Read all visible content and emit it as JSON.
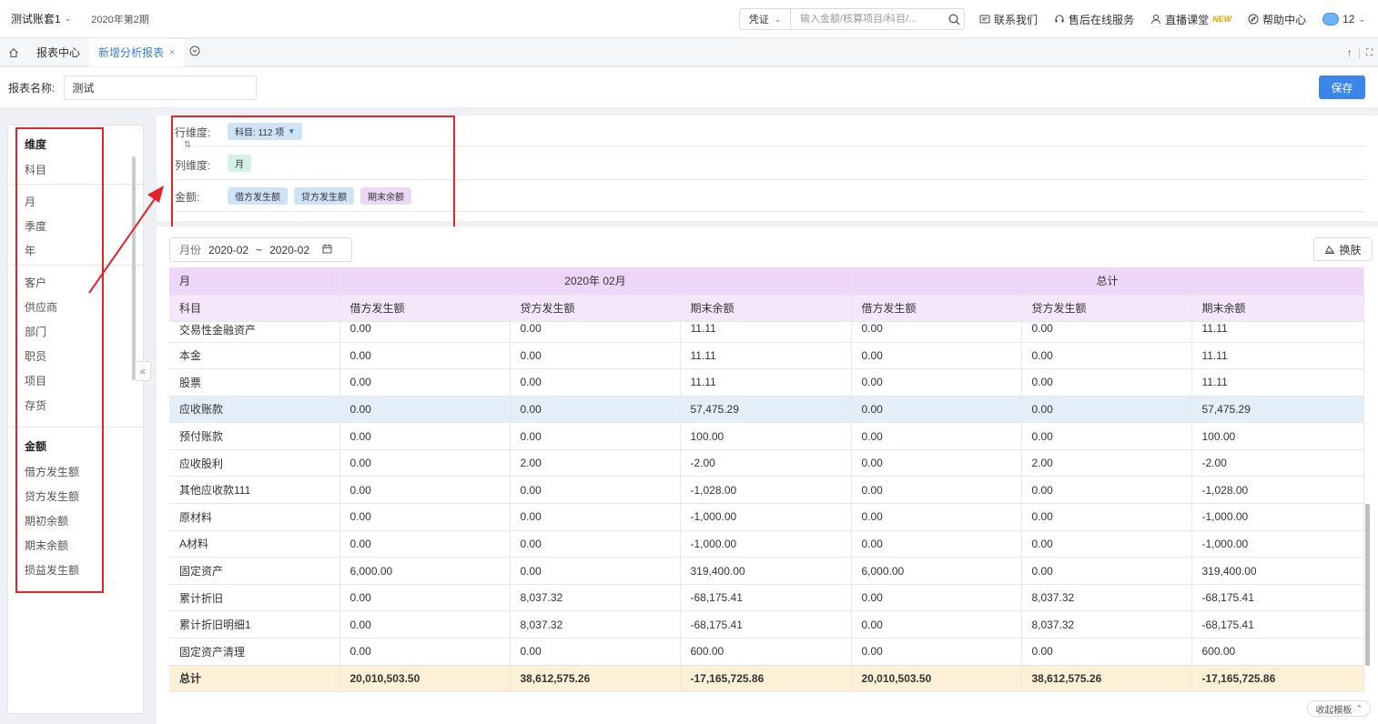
{
  "topbar": {
    "account": "测试账套1",
    "period": "2020年第2期",
    "search_type": "凭证",
    "search_placeholder": "输入金额/核算项目/科目/...",
    "links": {
      "contact": "联系我们",
      "service": "售后在线服务",
      "live": "直播课堂",
      "live_badge": "NEW",
      "help": "帮助中心"
    },
    "user_count": "12"
  },
  "tabs": {
    "report_center": "报表中心",
    "new_report": "新增分析报表",
    "close": "×"
  },
  "name_row": {
    "label": "报表名称:",
    "value": "测试",
    "save": "保存"
  },
  "left_panel": {
    "dim_header": "维度",
    "subject": "科目",
    "time_items": [
      "月",
      "季度",
      "年"
    ],
    "aux_items": [
      "客户",
      "供应商",
      "部门",
      "职员",
      "项目",
      "存货"
    ],
    "amount_header": "金额",
    "amount_items": [
      "借方发生额",
      "贷方发生额",
      "期初余额",
      "期末余额",
      "损益发生额"
    ]
  },
  "dims": {
    "row_label": "行维度:",
    "row_chip": "科目: 112 项",
    "col_label": "列维度:",
    "col_chip": "月",
    "amount_label": "金额:",
    "amount_chips": [
      "借方发生额",
      "贷方发生额",
      "期末余额"
    ]
  },
  "filter": {
    "label": "月份",
    "from": "2020-02",
    "sep": "~",
    "to": "2020-02",
    "skin": "换肤"
  },
  "table": {
    "h1": [
      "月",
      "2020年 02月",
      "总计"
    ],
    "h2": [
      "科目",
      "借方发生额",
      "贷方发生额",
      "期末余额",
      "借方发生额",
      "贷方发生额",
      "期末余额"
    ],
    "rows": [
      [
        "交易性金融资产",
        "0.00",
        "0.00",
        "11.11",
        "0.00",
        "0.00",
        "11.11"
      ],
      [
        "本金",
        "0.00",
        "0.00",
        "11.11",
        "0.00",
        "0.00",
        "11.11"
      ],
      [
        "股票",
        "0.00",
        "0.00",
        "11.11",
        "0.00",
        "0.00",
        "11.11"
      ],
      [
        "应收账款",
        "0.00",
        "0.00",
        "57,475.29",
        "0.00",
        "0.00",
        "57,475.29"
      ],
      [
        "预付账款",
        "0.00",
        "0.00",
        "100.00",
        "0.00",
        "0.00",
        "100.00"
      ],
      [
        "应收股利",
        "0.00",
        "2.00",
        "-2.00",
        "0.00",
        "2.00",
        "-2.00"
      ],
      [
        "其他应收款111",
        "0.00",
        "0.00",
        "-1,028.00",
        "0.00",
        "0.00",
        "-1,028.00"
      ],
      [
        "原材料",
        "0.00",
        "0.00",
        "-1,000.00",
        "0.00",
        "0.00",
        "-1,000.00"
      ],
      [
        "A材料",
        "0.00",
        "0.00",
        "-1,000.00",
        "0.00",
        "0.00",
        "-1,000.00"
      ],
      [
        "固定资产",
        "6,000.00",
        "0.00",
        "319,400.00",
        "6,000.00",
        "0.00",
        "319,400.00"
      ],
      [
        "累计折旧",
        "0.00",
        "8,037.32",
        "-68,175.41",
        "0.00",
        "8,037.32",
        "-68,175.41"
      ],
      [
        "累计折旧明细1",
        "0.00",
        "8,037.32",
        "-68,175.41",
        "0.00",
        "8,037.32",
        "-68,175.41"
      ],
      [
        "固定资产清理",
        "0.00",
        "0.00",
        "600.00",
        "0.00",
        "0.00",
        "600.00"
      ]
    ],
    "total": [
      "总计",
      "20,010,503.50",
      "38,612,575.26",
      "-17,165,725.86",
      "20,010,503.50",
      "38,612,575.26",
      "-17,165,725.86"
    ]
  },
  "fold": "收起模板",
  "colors": {
    "accent": "#3b86e8",
    "annotation_red": "#e5232a",
    "header_purple": "#eed6f8",
    "total_row": "#fdf0d6",
    "highlight_row": "#e4eef9"
  }
}
